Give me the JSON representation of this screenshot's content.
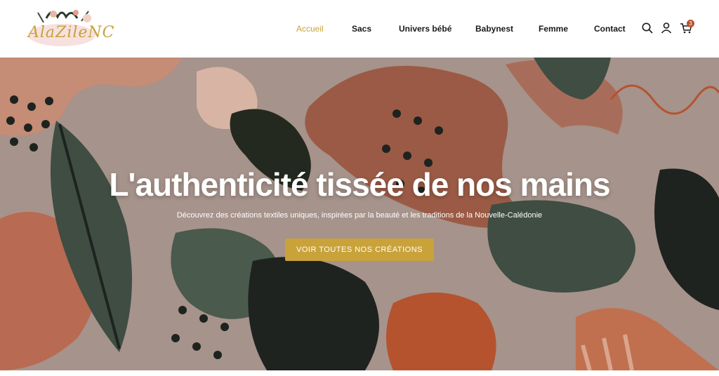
{
  "logo": {
    "text": "AlaZileNC"
  },
  "nav": {
    "items": [
      {
        "label": "Accueil"
      },
      {
        "label": "Sacs"
      },
      {
        "label": "Univers bébé"
      },
      {
        "label": "Babynest"
      },
      {
        "label": "Femme"
      },
      {
        "label": "Contact"
      }
    ],
    "active_index": 0
  },
  "icons": {
    "search": "search-icon",
    "account": "user-icon",
    "cart": "cart-icon",
    "cart_count": "3"
  },
  "hero": {
    "title": "L'authenticité tissée de nos mains",
    "subtitle": "Découvrez des créations textiles uniques, inspirées par la beauté et les traditions de la Nouvelle-Calédonie",
    "cta_label": "VOIR TOUTES NOS CRÉATIONS"
  },
  "colors": {
    "accent": "#c9a23a",
    "terracotta": "#b5532f",
    "forest": "#3f4d43",
    "dark": "#1e231f",
    "background_hero": "#a6938b"
  }
}
